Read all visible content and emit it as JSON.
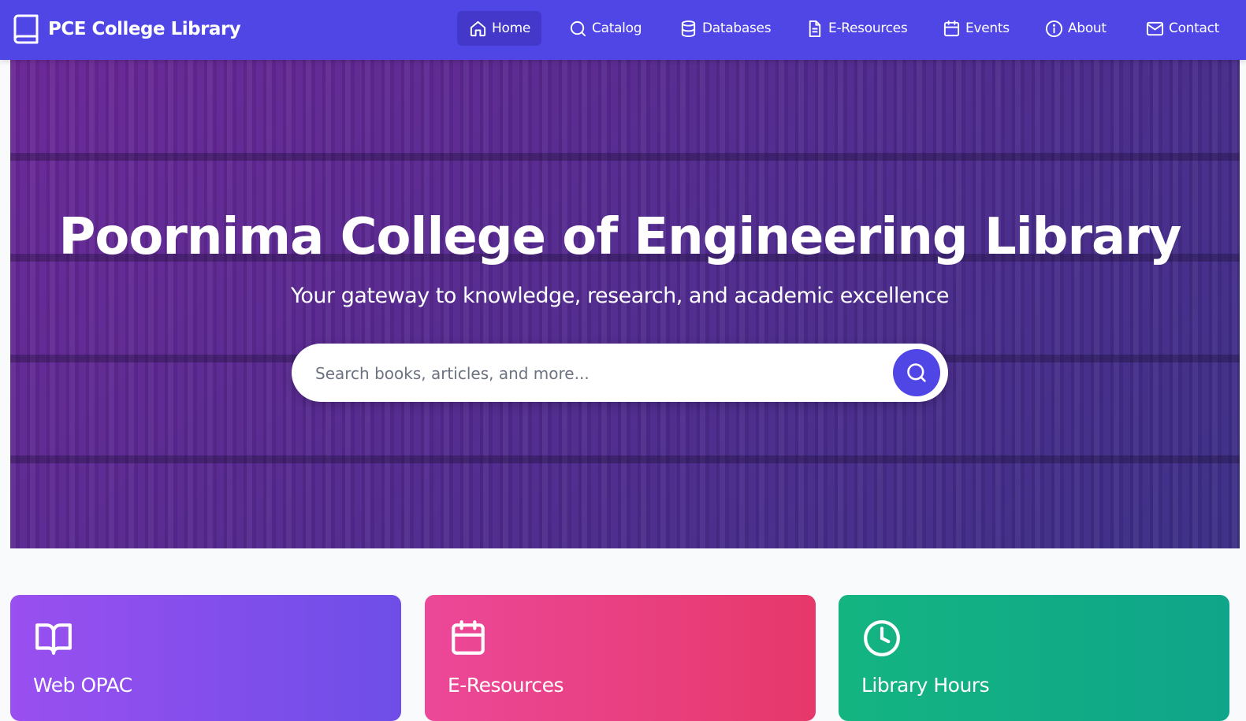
{
  "brand": {
    "name": "PCE College Library",
    "icon": "book-icon"
  },
  "nav": {
    "items": [
      {
        "label": "Home",
        "icon": "home-icon",
        "active": true
      },
      {
        "label": "Catalog",
        "icon": "search-icon"
      },
      {
        "label": "Databases",
        "icon": "database-icon"
      },
      {
        "label": "E-Resources",
        "icon": "document-icon"
      },
      {
        "label": "Events",
        "icon": "calendar-icon"
      },
      {
        "label": "About",
        "icon": "info-icon"
      },
      {
        "label": "Contact",
        "icon": "mail-icon"
      }
    ]
  },
  "hero": {
    "title": "Poornima College of Engineering Library",
    "subtitle": "Your gateway to knowledge, research, and academic excellence",
    "search": {
      "placeholder": "Search books, articles, and more...",
      "value": ""
    }
  },
  "cards": [
    {
      "title": "Web OPAC",
      "icon": "open-book-icon"
    },
    {
      "title": "E-Resources",
      "icon": "calendar-icon"
    },
    {
      "title": "Library Hours",
      "icon": "clock-icon"
    }
  ],
  "colors": {
    "nav_bg": "#4f46e5",
    "nav_active": "#4338ca",
    "search_button": "#4f46e5",
    "card_opac": "#8b5cf6",
    "card_eresources": "#ec4899",
    "card_hours": "#10b981"
  }
}
